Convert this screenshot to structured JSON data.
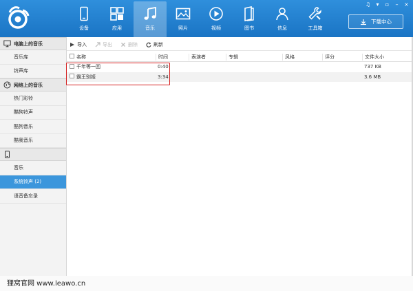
{
  "window": {
    "controls": [
      "♫",
      "▾",
      "▫",
      "–",
      "×"
    ]
  },
  "nav": {
    "items": [
      {
        "label": "设备",
        "icon": "phone-icon"
      },
      {
        "label": "应用",
        "icon": "apps-grid-icon"
      },
      {
        "label": "音乐",
        "icon": "music-note-icon"
      },
      {
        "label": "照片",
        "icon": "photo-icon"
      },
      {
        "label": "视频",
        "icon": "play-icon"
      },
      {
        "label": "图书",
        "icon": "book-icon"
      },
      {
        "label": "信息",
        "icon": "person-icon"
      },
      {
        "label": "工具箱",
        "icon": "wrench-icon"
      }
    ],
    "active_index": 2,
    "download_label": "下载中心"
  },
  "sidebar": {
    "groups": [
      {
        "title": "电脑上的音乐",
        "icon": "monitor-icon",
        "items": [
          "音乐库",
          "铃声库"
        ]
      },
      {
        "title": "网络上的音乐",
        "icon": "globe-icon",
        "items": [
          "热门彩铃",
          "酷狗铃声",
          "酷狗音乐",
          "酷我音乐"
        ]
      },
      {
        "title": "",
        "icon": "device-icon",
        "items": [
          "音乐",
          "系统铃声 (2)",
          "语音备忘录"
        ]
      }
    ],
    "selected": "系统铃声 (2)"
  },
  "toolbar": {
    "import": "导入",
    "export": "导出",
    "delete": "删除",
    "refresh": "刷新"
  },
  "table": {
    "columns": [
      "名称",
      "时间",
      "表演者",
      "专辑",
      "风格",
      "评分",
      "文件大小"
    ],
    "rows": [
      {
        "name": "千年等一回",
        "time": "0:40",
        "artist": "",
        "album": "",
        "style": "",
        "rating": "",
        "size": "737 KB"
      },
      {
        "name": "霸王别姬",
        "time": "3:34",
        "artist": "",
        "album": "",
        "style": "",
        "rating": "",
        "size": "3.6 MB"
      }
    ]
  },
  "watermark": "狸窝官网  www.leawo.cn",
  "colors": {
    "accent": "#1f7fd0",
    "selected": "#3b96dc",
    "highlight": "#d42020"
  }
}
